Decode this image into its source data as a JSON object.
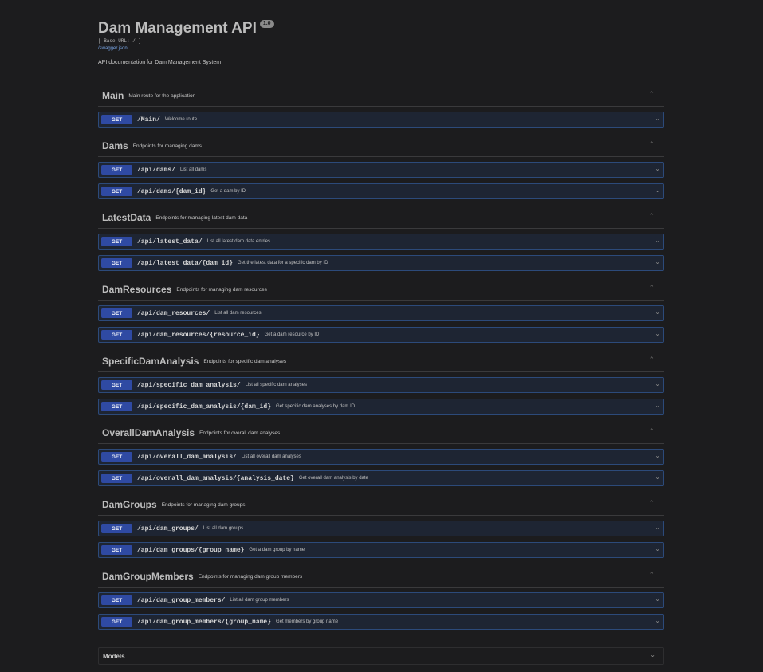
{
  "info": {
    "title": "Dam Management API",
    "version": "1.0",
    "base_url": "[ Base URL: / ]",
    "spec_link": "/swagger.json",
    "description": "API documentation for Dam Management System"
  },
  "tags": [
    {
      "name": "Main",
      "description": "Main route for the application",
      "operations": [
        {
          "method": "GET",
          "path": "/Main/",
          "summary": "Welcome route"
        }
      ]
    },
    {
      "name": "Dams",
      "description": "Endpoints for managing dams",
      "operations": [
        {
          "method": "GET",
          "path": "/api/dams/",
          "summary": "List all dams"
        },
        {
          "method": "GET",
          "path": "/api/dams/{dam_id}",
          "summary": "Get a dam by ID"
        }
      ]
    },
    {
      "name": "LatestData",
      "description": "Endpoints for managing latest dam data",
      "operations": [
        {
          "method": "GET",
          "path": "/api/latest_data/",
          "summary": "List all latest dam data entries"
        },
        {
          "method": "GET",
          "path": "/api/latest_data/{dam_id}",
          "summary": "Get the latest data for a specific dam by ID"
        }
      ]
    },
    {
      "name": "DamResources",
      "description": "Endpoints for managing dam resources",
      "operations": [
        {
          "method": "GET",
          "path": "/api/dam_resources/",
          "summary": "List all dam resources"
        },
        {
          "method": "GET",
          "path": "/api/dam_resources/{resource_id}",
          "summary": "Get a dam resource by ID"
        }
      ]
    },
    {
      "name": "SpecificDamAnalysis",
      "description": "Endpoints for specific dam analyses",
      "operations": [
        {
          "method": "GET",
          "path": "/api/specific_dam_analysis/",
          "summary": "List all specific dam analyses"
        },
        {
          "method": "GET",
          "path": "/api/specific_dam_analysis/{dam_id}",
          "summary": "Get specific dam analyses by dam ID"
        }
      ]
    },
    {
      "name": "OverallDamAnalysis",
      "description": "Endpoints for overall dam analyses",
      "operations": [
        {
          "method": "GET",
          "path": "/api/overall_dam_analysis/",
          "summary": "List all overall dam analyses"
        },
        {
          "method": "GET",
          "path": "/api/overall_dam_analysis/{analysis_date}",
          "summary": "Get overall dam analysis by date"
        }
      ]
    },
    {
      "name": "DamGroups",
      "description": "Endpoints for managing dam groups",
      "operations": [
        {
          "method": "GET",
          "path": "/api/dam_groups/",
          "summary": "List all dam groups"
        },
        {
          "method": "GET",
          "path": "/api/dam_groups/{group_name}",
          "summary": "Get a dam group by name"
        }
      ]
    },
    {
      "name": "DamGroupMembers",
      "description": "Endpoints for managing dam group members",
      "operations": [
        {
          "method": "GET",
          "path": "/api/dam_group_members/",
          "summary": "List all dam group members"
        },
        {
          "method": "GET",
          "path": "/api/dam_group_members/{group_name}",
          "summary": "Get members by group name"
        }
      ]
    }
  ],
  "models": {
    "label": "Models"
  },
  "colors": {
    "get_badge": "#2f4aa3",
    "op_border": "#2c4a7a",
    "background": "#1c1c1e",
    "link": "#7aa7e8"
  },
  "icons": {
    "tag_toggle": "chevron-up-icon",
    "op_toggle": "chevron-down-icon"
  }
}
